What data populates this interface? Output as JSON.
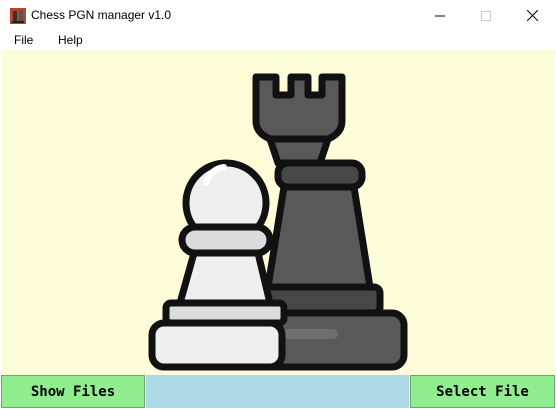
{
  "window": {
    "title": "Chess PGN manager v1.0",
    "icon": "chess-app-icon"
  },
  "menu": {
    "items": [
      {
        "label": "File"
      },
      {
        "label": "Help"
      }
    ]
  },
  "canvas": {
    "background": "#fffcd9",
    "image": "chess-pawn-and-rook-illustration"
  },
  "buttons": {
    "show_files": "Show Files",
    "select_file": "Select File"
  },
  "colors": {
    "button_green": "#90ee90",
    "field_blue": "#add8e6"
  }
}
